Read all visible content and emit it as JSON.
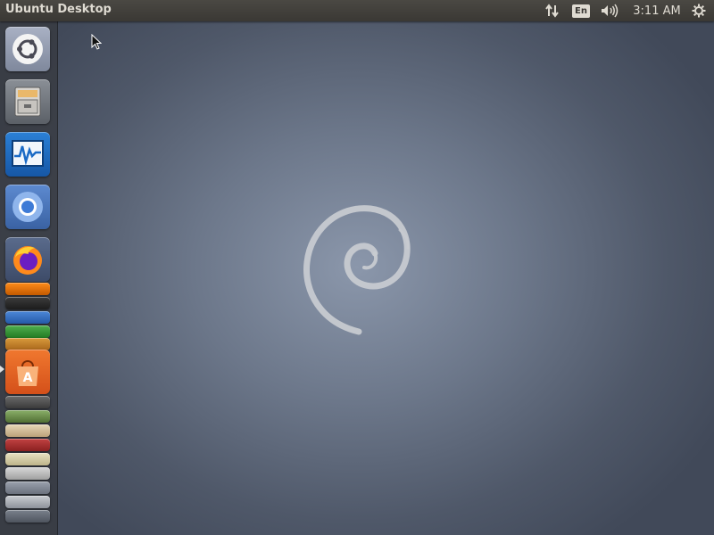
{
  "top_panel": {
    "title": "Ubuntu Desktop",
    "keyboard_layout": "En",
    "clock": "3:11 AM",
    "indicators": [
      "network-icon",
      "keyboard-layout",
      "sound-icon",
      "clock",
      "session-gear-icon"
    ]
  },
  "launcher": {
    "items": [
      {
        "name": "dash-home",
        "icon": "ubuntu-logo-icon"
      },
      {
        "name": "files",
        "icon": "file-cabinet-icon"
      },
      {
        "name": "system-monitor",
        "icon": "system-monitor-icon"
      },
      {
        "name": "chromium",
        "icon": "chromium-icon"
      },
      {
        "name": "firefox",
        "icon": "firefox-icon"
      },
      {
        "name": "vlc",
        "icon": "vlc-cone-icon"
      },
      {
        "name": "terminal",
        "icon": "terminal-icon"
      },
      {
        "name": "writer",
        "icon": "document-icon"
      },
      {
        "name": "calc",
        "icon": "spreadsheet-icon"
      },
      {
        "name": "impress",
        "icon": "presentation-icon"
      },
      {
        "name": "software-center",
        "icon": "software-center-icon",
        "text": "A"
      },
      {
        "name": "updater",
        "icon": "update-icon"
      },
      {
        "name": "mail",
        "icon": "mail-icon"
      },
      {
        "name": "tweak",
        "icon": "tools-icon"
      },
      {
        "name": "notes",
        "icon": "notes-icon"
      },
      {
        "name": "trash",
        "icon": "trash-icon"
      }
    ]
  },
  "desktop": {
    "wallpaper": "debian-swirl",
    "background_color": "#6c778a",
    "swirl_color": "#c9ccd1"
  },
  "colors": {
    "panel": "#3a3834",
    "panel_text": "#dfdbd2",
    "launcher": "#373a40",
    "accent": "#e95420"
  }
}
